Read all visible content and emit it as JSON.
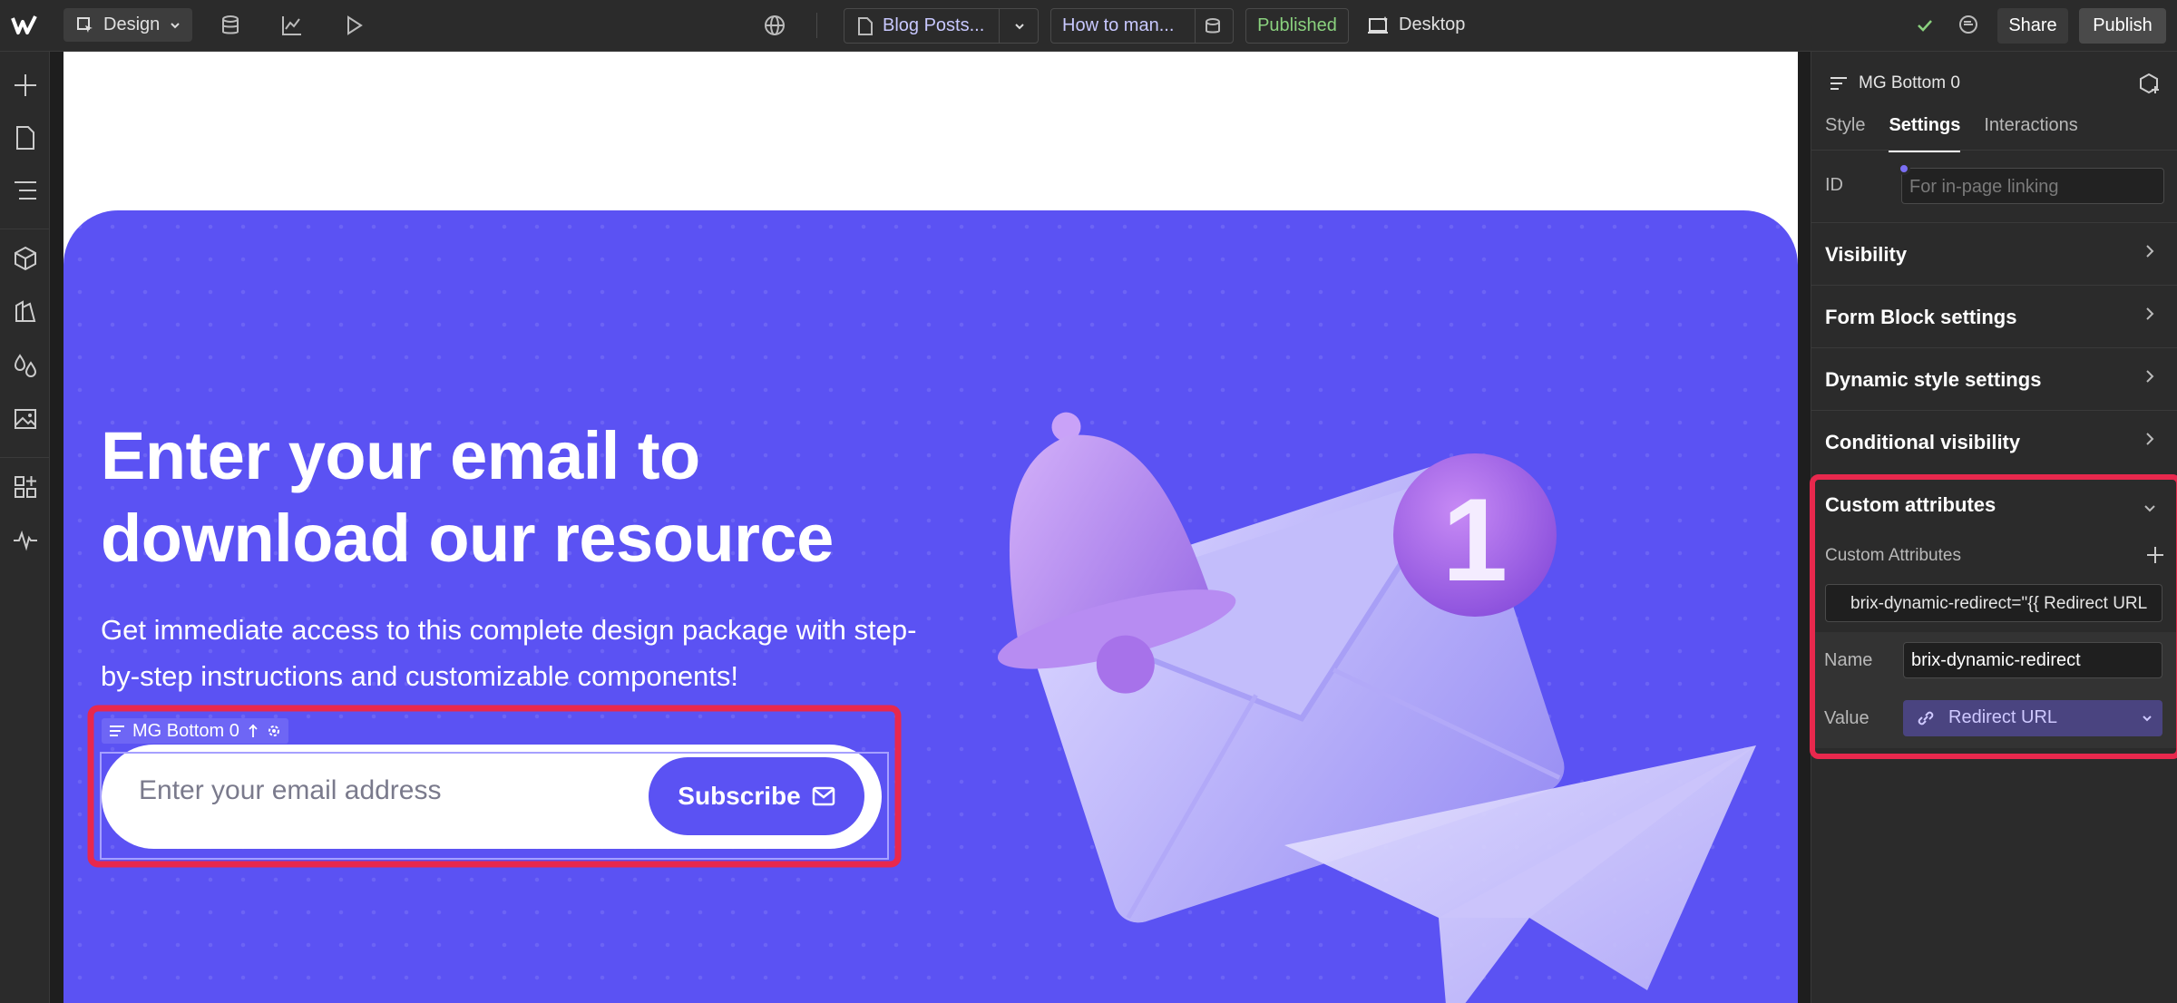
{
  "topbar": {
    "mode_label": "Design",
    "page_selector": "Blog Posts...",
    "cms_item": "How to man...",
    "status": "Published",
    "breakpoint": "Desktop",
    "share_label": "Share",
    "publish_label": "Publish"
  },
  "canvas": {
    "hero_title": "Enter your email to download our resource",
    "hero_subtitle": "Get immediate access to this complete design package with step-by-step instructions and customizable components!",
    "selected_element_label": "MG Bottom 0",
    "email_placeholder": "Enter your email address",
    "subscribe_label": "Subscribe",
    "notification_count": "1"
  },
  "panel": {
    "element_name": "MG Bottom 0",
    "tabs": [
      {
        "label": "Style",
        "active": false
      },
      {
        "label": "Settings",
        "active": true
      },
      {
        "label": "Interactions",
        "active": false
      }
    ],
    "id_label": "ID",
    "id_placeholder": "For in-page linking",
    "sections": [
      {
        "title": "Visibility"
      },
      {
        "title": "Form Block settings"
      },
      {
        "title": "Dynamic style settings"
      },
      {
        "title": "Conditional visibility"
      }
    ],
    "custom_attributes": {
      "title": "Custom attributes",
      "subtitle": "Custom Attributes",
      "item_preview": "brix-dynamic-redirect=\"{{ Redirect URL",
      "name_label": "Name",
      "name_value": "brix-dynamic-redirect",
      "value_label": "Value",
      "value_binding": "Redirect URL"
    }
  },
  "colors": {
    "accent": "#5b52f3",
    "highlight": "#e8284d",
    "published": "#8ad17e"
  }
}
